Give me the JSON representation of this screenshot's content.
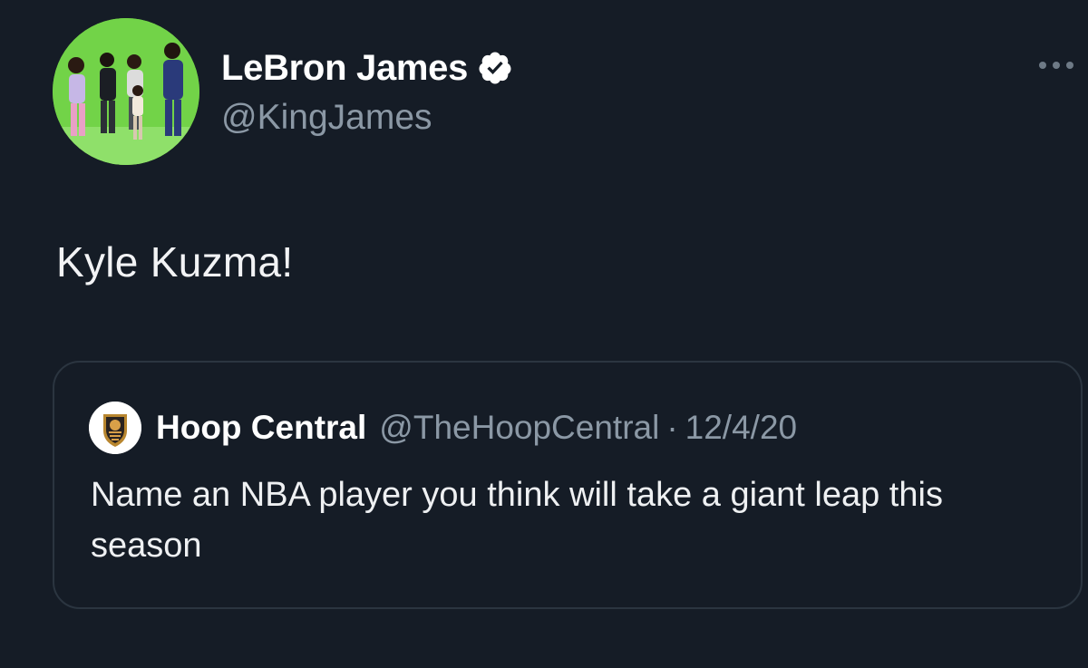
{
  "author": {
    "display_name": "LeBron James",
    "handle": "@KingJames",
    "verified": true,
    "avatar_icon": "group-photo-avatar"
  },
  "tweet": {
    "text": "Kyle Kuzma!"
  },
  "more_icon": "ellipsis-icon",
  "quoted_tweet": {
    "display_name": "Hoop Central",
    "handle": "@TheHoopCentral",
    "separator": "·",
    "date": "12/4/20",
    "text": "Name an NBA player you think will take a giant leap this season",
    "avatar_icon": "hoop-central-logo"
  },
  "colors": {
    "background": "#151c26",
    "secondary_text": "#8b98a5",
    "border": "#2b3540",
    "verified_badge": "#ffffff"
  }
}
